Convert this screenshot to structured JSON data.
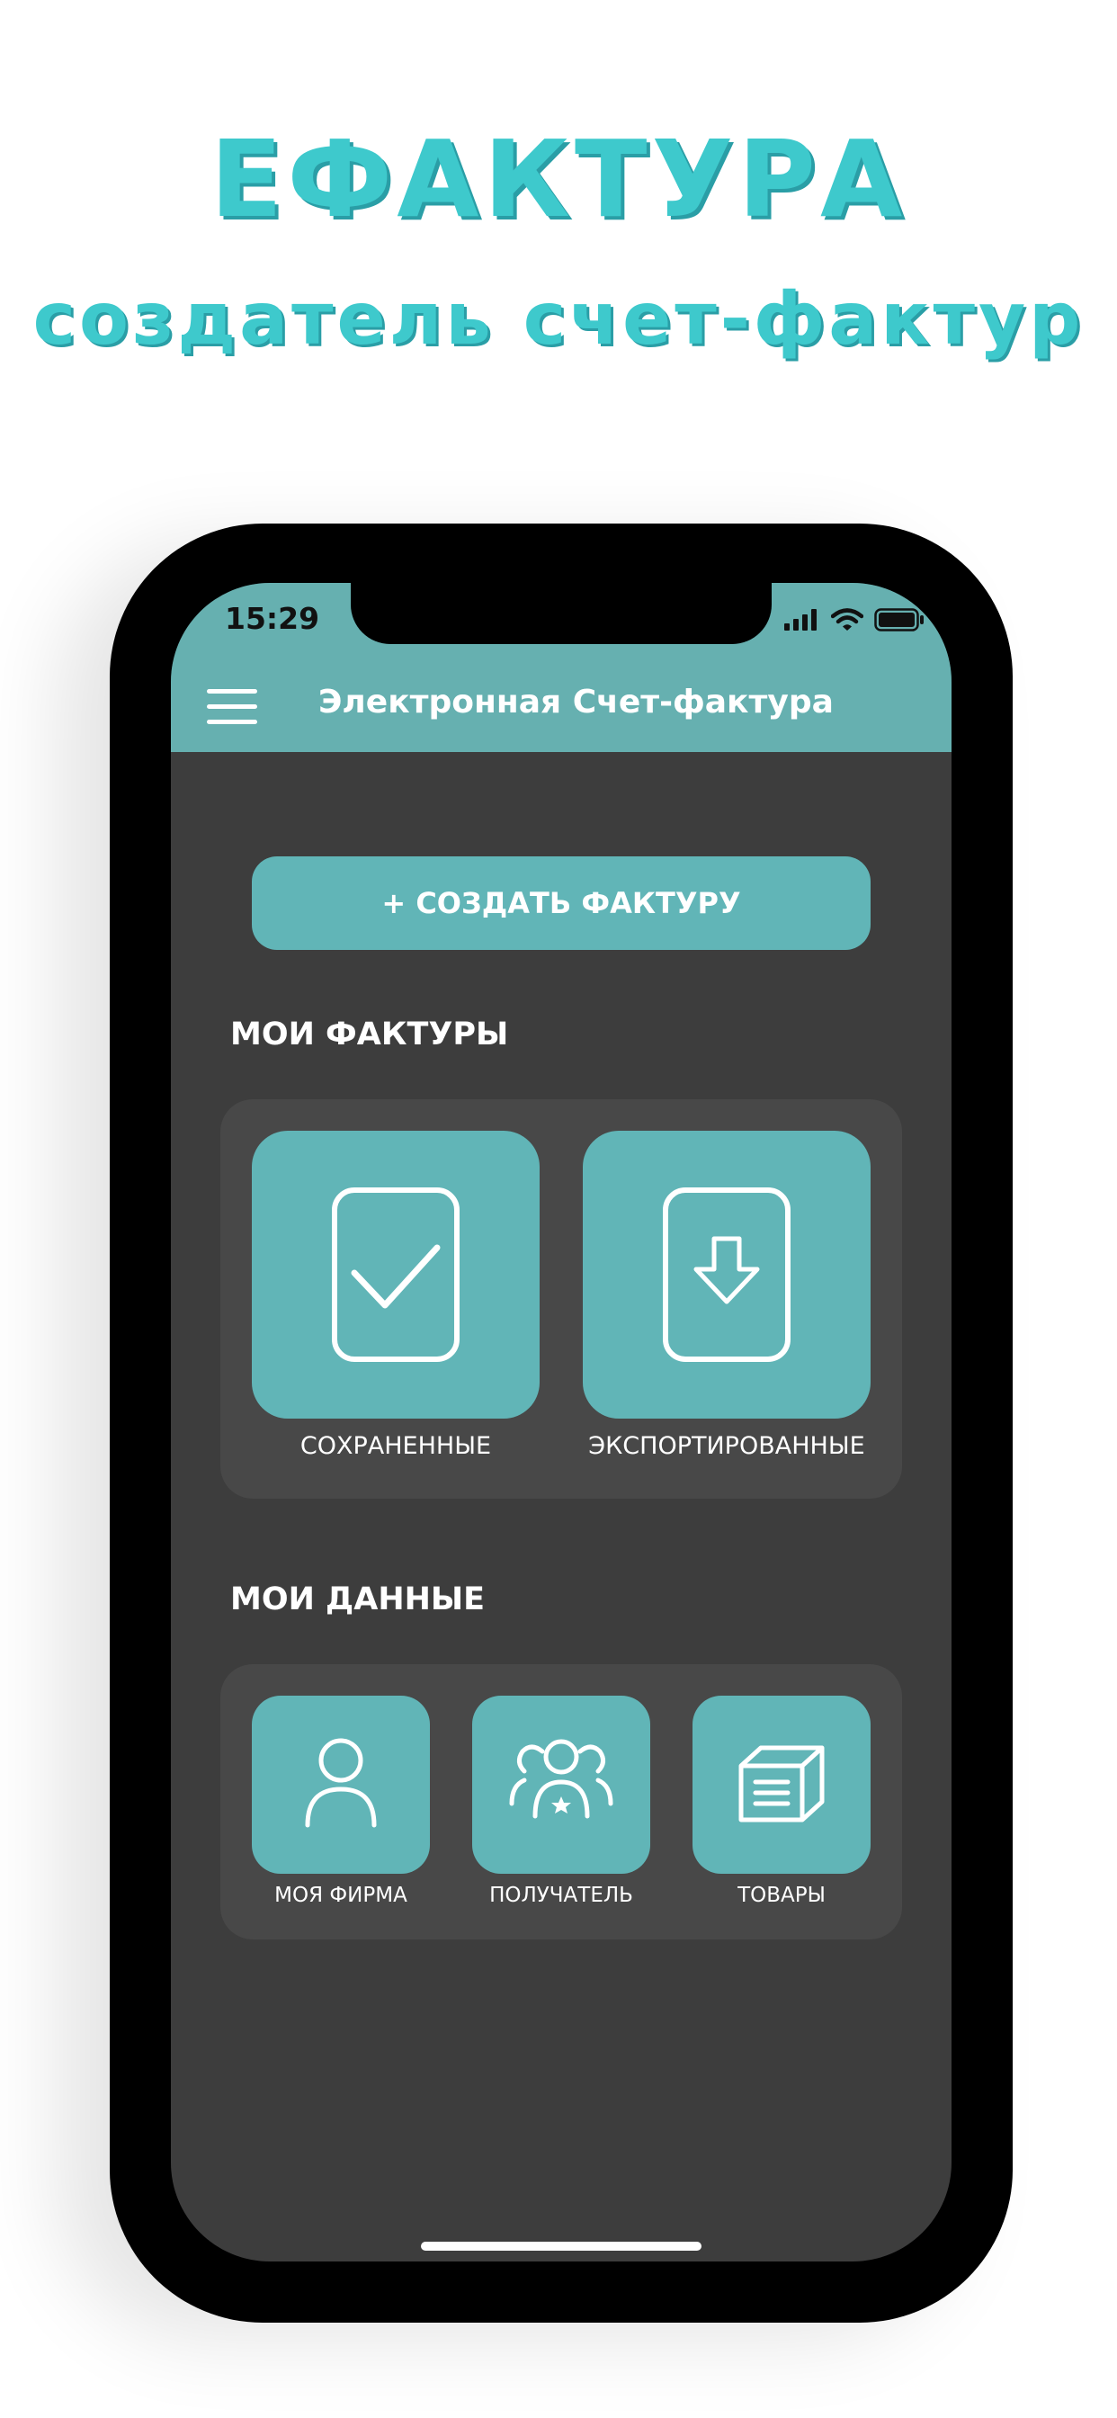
{
  "promo": {
    "title": "ЕФАКТУРА",
    "subtitle": "создатель счет-фактур"
  },
  "status_bar": {
    "time": "15:29",
    "icons": [
      "signal-icon",
      "wifi-icon",
      "battery-icon"
    ]
  },
  "header": {
    "menu_icon": "hamburger-icon",
    "title": "Электронная Счет-фактура"
  },
  "create_button": {
    "label": "+ СОЗДАТЬ ФАКТУРУ"
  },
  "my_invoices": {
    "title": "МОИ ФАКТУРЫ",
    "items": [
      {
        "label": "СОХРАНЕННЫЕ",
        "icon": "saved-check-icon"
      },
      {
        "label": "ЭКСПОРТИРОВАННЫЕ",
        "icon": "export-download-icon"
      }
    ]
  },
  "my_data": {
    "title": "МОИ ДАННЫЕ",
    "items": [
      {
        "label": "МОЯ ФИРМА",
        "icon": "person-icon"
      },
      {
        "label": "ПОЛУЧАТЕЛЬ",
        "icon": "group-icon"
      },
      {
        "label": "ТОВАРЫ",
        "icon": "box-icon"
      }
    ]
  },
  "colors": {
    "accent": "#61b5b7",
    "header": "#66b0b0",
    "background": "#3d3d3d",
    "panel": "#484848",
    "promo_text": "#3ec9cc"
  }
}
